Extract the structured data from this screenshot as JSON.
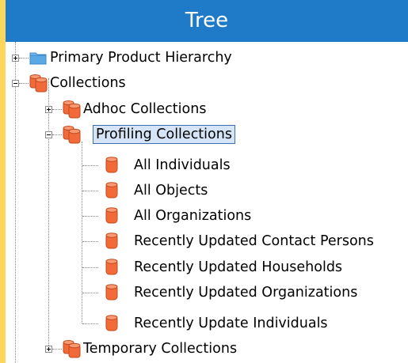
{
  "title": "Tree",
  "colors": {
    "accent": "#1f7ac7",
    "collection_icon": "#f26a3a",
    "folder_icon": "#5aa9e6"
  },
  "nodes": [
    {
      "label": "Primary Product Hierarchy",
      "icon": "folder-icon",
      "expander": "plus"
    },
    {
      "label": "Collections",
      "icon": "collection-group-icon",
      "expander": "minus"
    },
    {
      "label": "Adhoc Collections",
      "icon": "collection-group-icon",
      "expander": "plus"
    },
    {
      "label": "Profiling Collections",
      "icon": "collection-group-icon",
      "expander": "minus",
      "selected": true
    },
    {
      "label": "All Individuals",
      "icon": "collection-icon"
    },
    {
      "label": "All Objects",
      "icon": "collection-icon"
    },
    {
      "label": "All Organizations",
      "icon": "collection-icon"
    },
    {
      "label": "Recently Updated Contact Persons",
      "icon": "collection-icon"
    },
    {
      "label": "Recently Updated Households",
      "icon": "collection-icon"
    },
    {
      "label": "Recently Updated Organizations",
      "icon": "collection-icon"
    },
    {
      "label": "Recently Update Individuals",
      "icon": "collection-icon"
    },
    {
      "label": "Temporary Collections",
      "icon": "collection-group-icon",
      "expander": "plus"
    }
  ]
}
